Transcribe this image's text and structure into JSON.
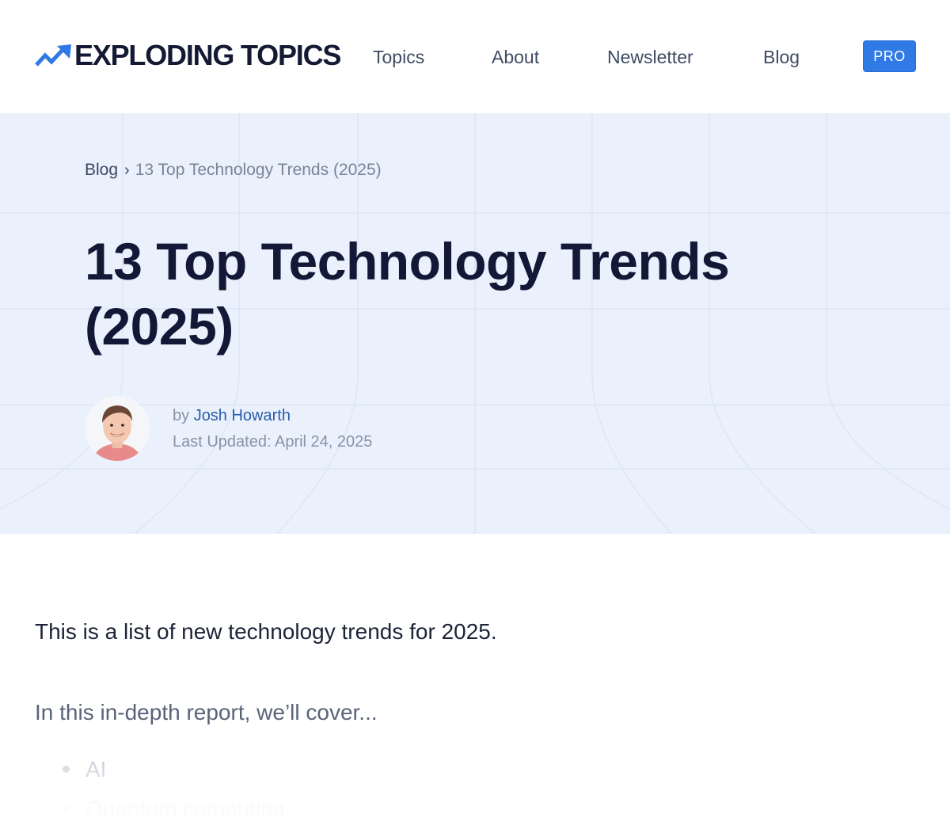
{
  "header": {
    "logo_text": "EXPLODING TOPICS",
    "nav": {
      "topics": "Topics",
      "about": "About",
      "newsletter": "Newsletter",
      "blog": "Blog"
    },
    "pro_label": "PRO"
  },
  "hero": {
    "breadcrumb": {
      "blog": "Blog",
      "separator": "›",
      "current": "13 Top Technology Trends (2025)"
    },
    "title": "13 Top Technology Trends (2025)",
    "byline_prefix": "by",
    "author": "Josh Howarth",
    "last_updated": "Last Updated: April 24, 2025"
  },
  "article": {
    "intro": "This is a list of new technology trends for 2025.",
    "cover_intro": "In this in-depth report, we’ll cover...",
    "topics": [
      "AI",
      "Quantum computing"
    ]
  },
  "colors": {
    "brand_blue": "#2f7ae5",
    "hero_background": "#eaf1fd",
    "title_navy": "#131836"
  }
}
